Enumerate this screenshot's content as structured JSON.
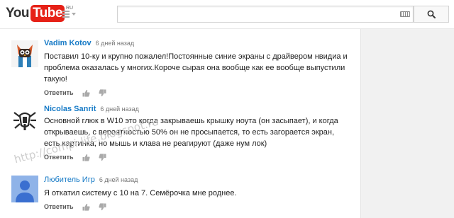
{
  "header": {
    "logo_you": "You",
    "logo_tube": "Tube",
    "logo_region": "RU",
    "search_placeholder": ""
  },
  "watermark": "http://compi-life.blogspot.ru",
  "comments": [
    {
      "author": "Vadim Kotov",
      "time": "6 дней назад",
      "text": "Поставил 10-ку и крупно пожалел!Постоянные синие экраны с драйвером нвидиа и проблема оказалась у многих.Короче сырая она вообще как ее вообще выпустили такую!",
      "reply": "Ответить",
      "avatar": "owl-avatar"
    },
    {
      "author": "Nicolas Sanrit",
      "time": "6 дней назад",
      "text": "Основной глюк в W10 это когда закрываешь крышку ноута (он засыпает), и когда открываешь, с вероятностью 50% он не просыпается, то есть загорается экран, есть картинка, но мышь и клава не реагируют (даже нум лок)",
      "reply": "Ответить",
      "avatar": "emblem-avatar"
    },
    {
      "author": "Любитель Игр",
      "time": "6 дней назад",
      "text": "Я откатил систему с 10 на 7. Семёрочка мне роднее.",
      "reply": "Ответить",
      "avatar": "default-user-avatar"
    }
  ],
  "colors": {
    "accent": "#167ac6",
    "logo_red": "#e62117",
    "page_bg": "#f1f1f1"
  }
}
